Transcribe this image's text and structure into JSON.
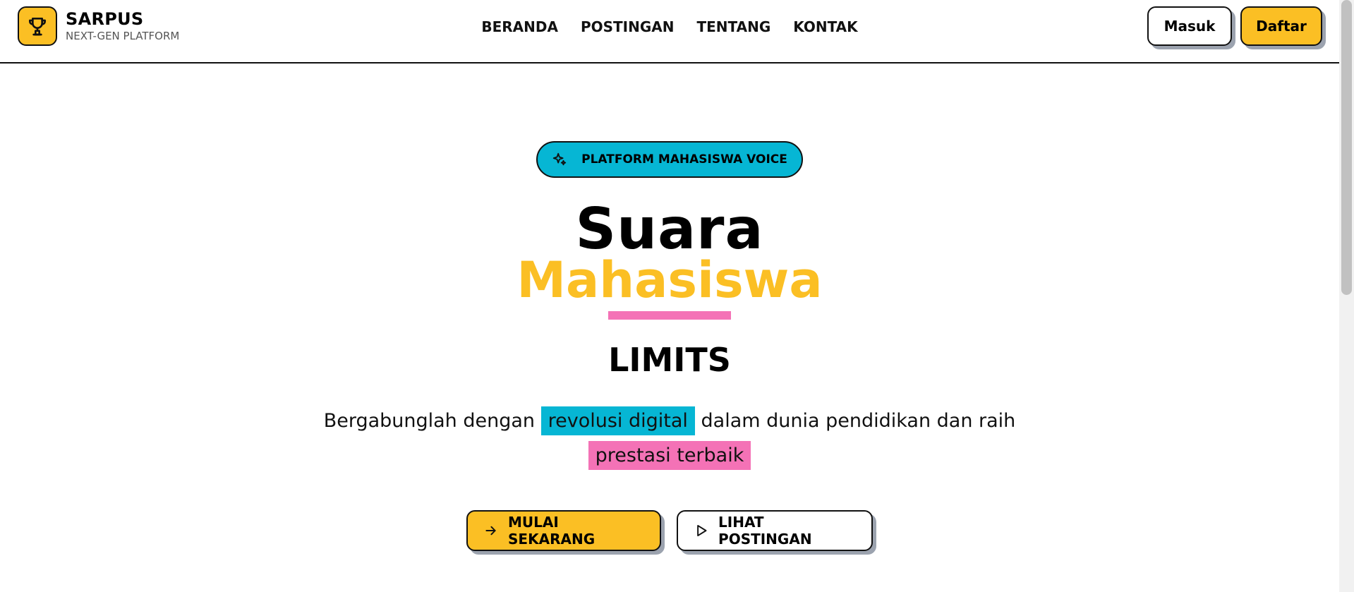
{
  "header": {
    "brand_name": "SARPUS",
    "brand_sub": "NEXT-GEN PLATFORM",
    "nav": [
      "BERANDA",
      "POSTINGAN",
      "TENTANG",
      "KONTAK"
    ],
    "login_label": "Masuk",
    "register_label": "Daftar"
  },
  "hero": {
    "badge": "PLATFORM MAHASISWA VOICE",
    "title_line1": "Suara",
    "title_line2": "Mahasiswa",
    "title_line3": "LIMITS",
    "desc_part1": "Bergabunglah dengan ",
    "desc_hl1": "revolusi digital",
    "desc_part2": " dalam dunia pendidikan dan raih",
    "desc_hl2": "prestasi terbaik",
    "cta_primary": "MULAI SEKARANG",
    "cta_secondary": "LIHAT POSTINGAN"
  },
  "colors": {
    "yellow": "#fbbf24",
    "cyan": "#06b6d4",
    "pink": "#f472b6"
  },
  "icons": [
    "trophy-icon",
    "sparkles-icon",
    "arrow-right-icon",
    "play-icon"
  ]
}
